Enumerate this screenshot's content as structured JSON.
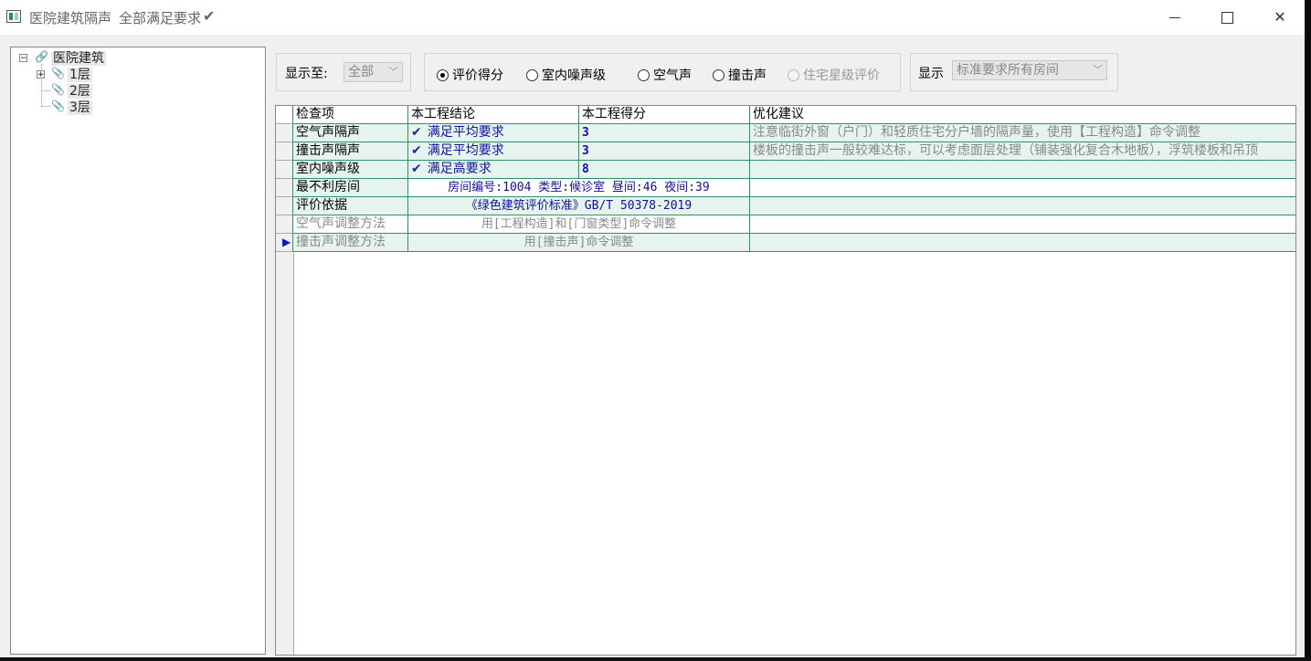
{
  "window": {
    "title": "医院建筑隔声",
    "status": "全部满足要求",
    "status_icon": "check-icon",
    "controls": [
      "minimize",
      "maximize",
      "close"
    ]
  },
  "tree": {
    "root": "医院建筑",
    "children": [
      "1层",
      "2层",
      "3层"
    ]
  },
  "toolbar": {
    "show_to_label": "显示至:",
    "show_to_value": "全部",
    "radios": [
      {
        "label": "评价得分",
        "selected": true,
        "enabled": true
      },
      {
        "label": "室内噪声级",
        "selected": false,
        "enabled": true
      },
      {
        "label": "空气声",
        "selected": false,
        "enabled": true
      },
      {
        "label": "撞击声",
        "selected": false,
        "enabled": true
      },
      {
        "label": "住宅星级评价",
        "selected": false,
        "enabled": false
      }
    ],
    "display_label": "显示",
    "display_value": "标准要求所有房间"
  },
  "grid": {
    "headers": [
      "检查项",
      "本工程结论",
      "本工程得分",
      "优化建议"
    ],
    "rows": [
      {
        "item": "空气声隔声",
        "conclusion": "满足平均要求",
        "score": "3",
        "advice": "注意临街外窗（户门）和轻质住宅分户墙的隔声量，使用【工程构造】命令调整"
      },
      {
        "item": "撞击声隔声",
        "conclusion": "满足平均要求",
        "score": "3",
        "advice": "楼板的撞击声一般较难达标，可以考虑面层处理（铺装强化复合木地板），浮筑楼板和吊顶"
      },
      {
        "item": "室内噪声级",
        "conclusion": "满足高要求",
        "score": "8",
        "advice": ""
      },
      {
        "item": "最不利房间",
        "merged": "房间编号:1004 类型:候诊室 昼间:46 夜间:39"
      },
      {
        "item": "评价依据",
        "merged": "《绿色建筑评价标准》GB/T 50378-2019"
      },
      {
        "item": "空气声调整方法",
        "merged": "用[工程构造]和[门窗类型]命令调整"
      },
      {
        "item": "撞击声调整方法",
        "merged": "用[撞击声]命令调整",
        "current": true
      }
    ]
  },
  "colors": {
    "grid_line": "#2f8f6f",
    "row_fill": "#e6f4ee",
    "value_text": "#1010a0"
  }
}
